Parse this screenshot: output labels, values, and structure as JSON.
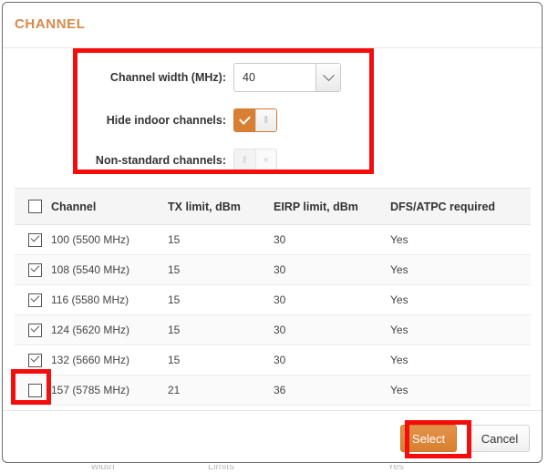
{
  "dialog": {
    "title": "CHANNEL"
  },
  "form": {
    "channel_width": {
      "label": "Channel width (MHz):",
      "value": "40",
      "arrow_icon": "chevron-down-icon"
    },
    "hide_indoor": {
      "label": "Hide indoor channels:",
      "state": "on",
      "on_glyph": "check-icon",
      "handle_glyph": "‖"
    },
    "non_standard": {
      "label": "Non-standard channels:",
      "state": "off",
      "handle_glyph": "‖",
      "off_glyph": "×"
    }
  },
  "table": {
    "headers": [
      "",
      "Channel",
      "TX limit, dBm",
      "EIRP limit, dBm",
      "DFS/ATPC required"
    ],
    "select_all_checked": false,
    "rows": [
      {
        "checked": true,
        "channel": "100 (5500 MHz)",
        "tx": "15",
        "eirp": "30",
        "dfs": "Yes"
      },
      {
        "checked": true,
        "channel": "108 (5540 MHz)",
        "tx": "15",
        "eirp": "30",
        "dfs": "Yes"
      },
      {
        "checked": true,
        "channel": "116 (5580 MHz)",
        "tx": "15",
        "eirp": "30",
        "dfs": "Yes"
      },
      {
        "checked": true,
        "channel": "124 (5620 MHz)",
        "tx": "15",
        "eirp": "30",
        "dfs": "Yes"
      },
      {
        "checked": true,
        "channel": "132 (5660 MHz)",
        "tx": "15",
        "eirp": "30",
        "dfs": "Yes"
      },
      {
        "checked": false,
        "channel": "157 (5785 MHz)",
        "tx": "21",
        "eirp": "36",
        "dfs": "Yes"
      }
    ]
  },
  "footer": {
    "select_label": "Select",
    "cancel_label": "Cancel"
  },
  "colors": {
    "title_orange": "#d68a4a",
    "accent_orange": "#d8802f",
    "toggle_on": "#d97f33",
    "annotation_red": "#f40d0d",
    "header_bg": "#f5f5f5",
    "dialog_border": "#6e6e6e"
  },
  "background_fragments": [
    "width",
    "Limits",
    "Yes"
  ]
}
